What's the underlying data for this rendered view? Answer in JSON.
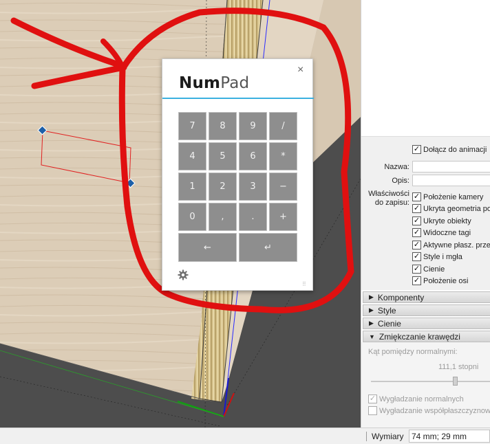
{
  "numpad": {
    "title_bold": "Num",
    "title_light": "Pad",
    "close": "×",
    "keys": [
      [
        "7",
        "8",
        "9",
        "/"
      ],
      [
        "4",
        "5",
        "6",
        "*"
      ],
      [
        "1",
        "2",
        "3",
        "−"
      ],
      [
        "0",
        ",",
        ".",
        "+"
      ]
    ],
    "backspace": "←",
    "enter": "↵",
    "settings_icon": "gear-icon",
    "accent_color": "#3ab0e0"
  },
  "scene": {
    "include_animation": "Dołącz do animacji",
    "name_label": "Nazwa:",
    "desc_label": "Opis:",
    "props_label_1": "Właściwości",
    "props_label_2": "do zapisu:",
    "props": [
      "Położenie kamery",
      "Ukryta geometria poz",
      "Ukryte obiekty",
      "Widoczne tagi",
      "Aktywne płasz. przek",
      "Style i mgła",
      "Cienie",
      "Położenie osi"
    ]
  },
  "tray": {
    "sections": [
      {
        "label": "Komponenty",
        "arrow": "▶"
      },
      {
        "label": "Style",
        "arrow": "▶"
      },
      {
        "label": "Cienie",
        "arrow": "▶"
      },
      {
        "label": "Zmiękczanie krawędzi",
        "arrow": "▼"
      }
    ],
    "soften": {
      "angle_label": "Kąt pomiędzy normalnymi:",
      "angle_value": "111,1  stopni",
      "slider_fraction": 0.7,
      "smooth_normals": "Wygładzanie normalnych",
      "soften_coplanar": "Wygładzanie współpłaszczyznowyc"
    }
  },
  "status": {
    "label": "Wymiary",
    "value": "74 mm; 29 mm"
  },
  "colors": {
    "annotation_red": "#e01010",
    "viewport_bg": "#4a4a4a",
    "wood": "#d9c9b2",
    "key_gray": "#8e8e8e"
  }
}
